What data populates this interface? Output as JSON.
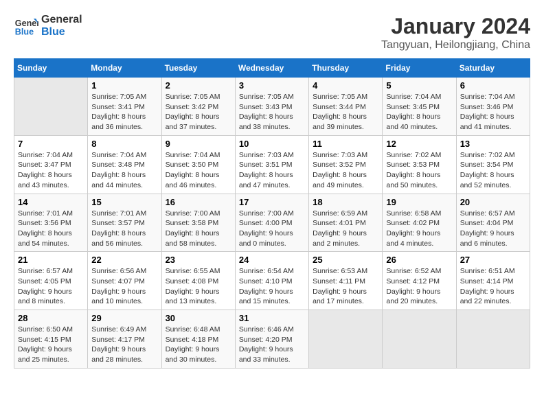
{
  "logo": {
    "line1": "General",
    "line2": "Blue"
  },
  "title": "January 2024",
  "subtitle": "Tangyuan, Heilongjiang, China",
  "days_of_week": [
    "Sunday",
    "Monday",
    "Tuesday",
    "Wednesday",
    "Thursday",
    "Friday",
    "Saturday"
  ],
  "weeks": [
    [
      {
        "day": "",
        "info": ""
      },
      {
        "day": "1",
        "info": "Sunrise: 7:05 AM\nSunset: 3:41 PM\nDaylight: 8 hours\nand 36 minutes."
      },
      {
        "day": "2",
        "info": "Sunrise: 7:05 AM\nSunset: 3:42 PM\nDaylight: 8 hours\nand 37 minutes."
      },
      {
        "day": "3",
        "info": "Sunrise: 7:05 AM\nSunset: 3:43 PM\nDaylight: 8 hours\nand 38 minutes."
      },
      {
        "day": "4",
        "info": "Sunrise: 7:05 AM\nSunset: 3:44 PM\nDaylight: 8 hours\nand 39 minutes."
      },
      {
        "day": "5",
        "info": "Sunrise: 7:04 AM\nSunset: 3:45 PM\nDaylight: 8 hours\nand 40 minutes."
      },
      {
        "day": "6",
        "info": "Sunrise: 7:04 AM\nSunset: 3:46 PM\nDaylight: 8 hours\nand 41 minutes."
      }
    ],
    [
      {
        "day": "7",
        "info": "Sunrise: 7:04 AM\nSunset: 3:47 PM\nDaylight: 8 hours\nand 43 minutes."
      },
      {
        "day": "8",
        "info": "Sunrise: 7:04 AM\nSunset: 3:48 PM\nDaylight: 8 hours\nand 44 minutes."
      },
      {
        "day": "9",
        "info": "Sunrise: 7:04 AM\nSunset: 3:50 PM\nDaylight: 8 hours\nand 46 minutes."
      },
      {
        "day": "10",
        "info": "Sunrise: 7:03 AM\nSunset: 3:51 PM\nDaylight: 8 hours\nand 47 minutes."
      },
      {
        "day": "11",
        "info": "Sunrise: 7:03 AM\nSunset: 3:52 PM\nDaylight: 8 hours\nand 49 minutes."
      },
      {
        "day": "12",
        "info": "Sunrise: 7:02 AM\nSunset: 3:53 PM\nDaylight: 8 hours\nand 50 minutes."
      },
      {
        "day": "13",
        "info": "Sunrise: 7:02 AM\nSunset: 3:54 PM\nDaylight: 8 hours\nand 52 minutes."
      }
    ],
    [
      {
        "day": "14",
        "info": "Sunrise: 7:01 AM\nSunset: 3:56 PM\nDaylight: 8 hours\nand 54 minutes."
      },
      {
        "day": "15",
        "info": "Sunrise: 7:01 AM\nSunset: 3:57 PM\nDaylight: 8 hours\nand 56 minutes."
      },
      {
        "day": "16",
        "info": "Sunrise: 7:00 AM\nSunset: 3:58 PM\nDaylight: 8 hours\nand 58 minutes."
      },
      {
        "day": "17",
        "info": "Sunrise: 7:00 AM\nSunset: 4:00 PM\nDaylight: 9 hours\nand 0 minutes."
      },
      {
        "day": "18",
        "info": "Sunrise: 6:59 AM\nSunset: 4:01 PM\nDaylight: 9 hours\nand 2 minutes."
      },
      {
        "day": "19",
        "info": "Sunrise: 6:58 AM\nSunset: 4:02 PM\nDaylight: 9 hours\nand 4 minutes."
      },
      {
        "day": "20",
        "info": "Sunrise: 6:57 AM\nSunset: 4:04 PM\nDaylight: 9 hours\nand 6 minutes."
      }
    ],
    [
      {
        "day": "21",
        "info": "Sunrise: 6:57 AM\nSunset: 4:05 PM\nDaylight: 9 hours\nand 8 minutes."
      },
      {
        "day": "22",
        "info": "Sunrise: 6:56 AM\nSunset: 4:07 PM\nDaylight: 9 hours\nand 10 minutes."
      },
      {
        "day": "23",
        "info": "Sunrise: 6:55 AM\nSunset: 4:08 PM\nDaylight: 9 hours\nand 13 minutes."
      },
      {
        "day": "24",
        "info": "Sunrise: 6:54 AM\nSunset: 4:10 PM\nDaylight: 9 hours\nand 15 minutes."
      },
      {
        "day": "25",
        "info": "Sunrise: 6:53 AM\nSunset: 4:11 PM\nDaylight: 9 hours\nand 17 minutes."
      },
      {
        "day": "26",
        "info": "Sunrise: 6:52 AM\nSunset: 4:12 PM\nDaylight: 9 hours\nand 20 minutes."
      },
      {
        "day": "27",
        "info": "Sunrise: 6:51 AM\nSunset: 4:14 PM\nDaylight: 9 hours\nand 22 minutes."
      }
    ],
    [
      {
        "day": "28",
        "info": "Sunrise: 6:50 AM\nSunset: 4:15 PM\nDaylight: 9 hours\nand 25 minutes."
      },
      {
        "day": "29",
        "info": "Sunrise: 6:49 AM\nSunset: 4:17 PM\nDaylight: 9 hours\nand 28 minutes."
      },
      {
        "day": "30",
        "info": "Sunrise: 6:48 AM\nSunset: 4:18 PM\nDaylight: 9 hours\nand 30 minutes."
      },
      {
        "day": "31",
        "info": "Sunrise: 6:46 AM\nSunset: 4:20 PM\nDaylight: 9 hours\nand 33 minutes."
      },
      {
        "day": "",
        "info": ""
      },
      {
        "day": "",
        "info": ""
      },
      {
        "day": "",
        "info": ""
      }
    ]
  ]
}
